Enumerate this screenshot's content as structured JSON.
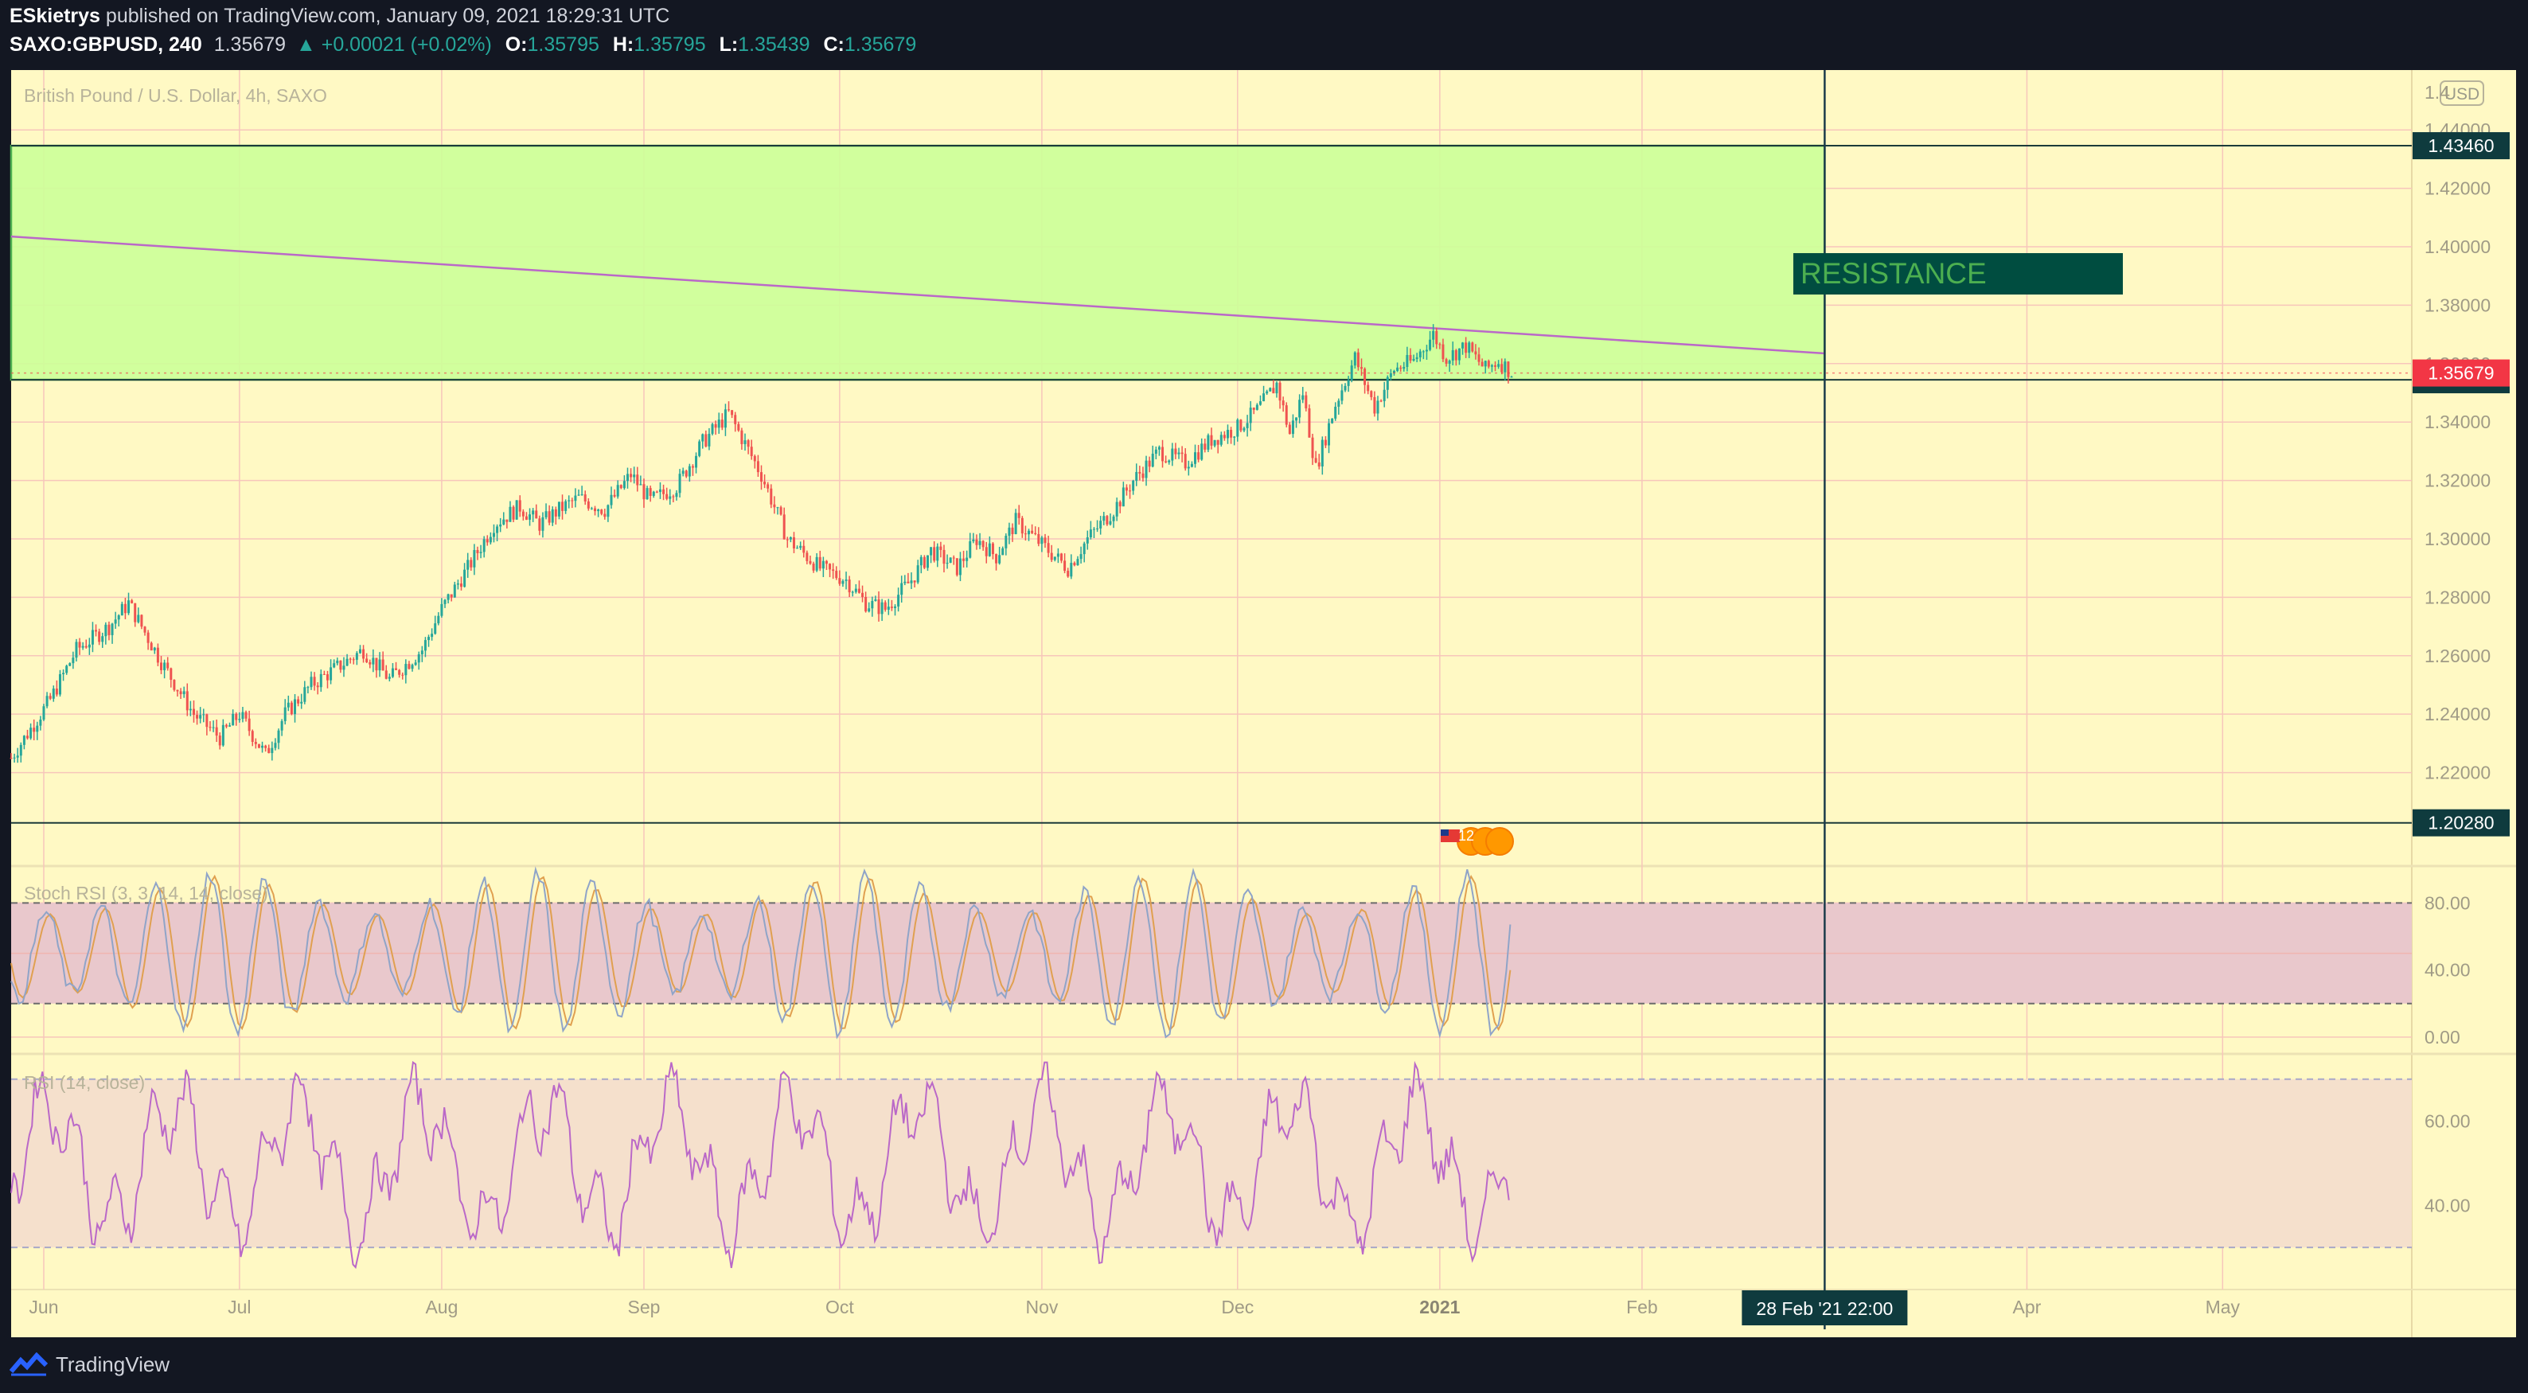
{
  "header": {
    "author": "ESkietrys",
    "published": "published on TradingView.com, January 09, 2021 18:29:31 UTC",
    "symbol": "SAXO:GBPUSD, 240",
    "last": "1.35679",
    "change": "▲ +0.00021 (+0.02%)",
    "o_label": "O:",
    "o_value": "1.35795",
    "h_label": "H:",
    "h_value": "1.35795",
    "l_label": "L:",
    "l_value": "1.35439",
    "c_label": "C:",
    "c_value": "1.35679"
  },
  "chart_data": {
    "type": "line",
    "title": "British Pound / U.S. Dollar, 4h, SAXO",
    "currency_badge": "USD",
    "price_axis": {
      "ylim": [
        1.188,
        1.4605
      ],
      "ticks": [
        "1.44000",
        "1.42000",
        "1.40000",
        "1.38000",
        "1.36000",
        "1.34000",
        "1.32000",
        "1.30000",
        "1.28000",
        "1.26000",
        "1.24000",
        "1.22000"
      ],
      "tick_values": [
        1.44,
        1.42,
        1.4,
        1.38,
        1.36,
        1.34,
        1.32,
        1.3,
        1.28,
        1.26,
        1.24,
        1.22
      ],
      "top_partial_label": "1.4"
    },
    "time_axis": {
      "labels": [
        "Jun",
        "Jul",
        "Aug",
        "Sep",
        "Oct",
        "Nov",
        "Dec",
        "2021",
        "Feb",
        "Mar",
        "Apr",
        "May"
      ],
      "day_offsets": [
        -15,
        15,
        46,
        77,
        107,
        138,
        168,
        199,
        230,
        258,
        289,
        319
      ],
      "crosshair_label": "28 Feb '21   22:00",
      "crosshair_day": 258,
      "xlim_days": [
        -20,
        348
      ]
    },
    "zones": [
      {
        "name": "RESISTANCE",
        "top": 1.4346,
        "bottom": 1.35448,
        "fill": "#ccff99",
        "stroke": "#4caf50"
      }
    ],
    "annotation": {
      "text": "RESISTANCE",
      "bg": "#004d40",
      "color": "#4caf50"
    },
    "horizontal_levels": [
      {
        "value": 1.4346,
        "label": "1.43460",
        "color": "#1b3b3a"
      },
      {
        "value": 1.35448,
        "label": "1.35448",
        "color": "#1b3b3a"
      },
      {
        "value": 1.2028,
        "label": "1.20280",
        "color": "#1b3b3a"
      }
    ],
    "last_price": {
      "value": 1.35679,
      "label": "1.35679",
      "color": "#f23645"
    },
    "trendline": {
      "from_day": -20,
      "from_value": 1.4035,
      "to_day": 258,
      "to_value": 1.3635,
      "color": "#ba68c8"
    },
    "series": [
      {
        "name": "GBPUSD",
        "x_days": [
          -20,
          -14,
          -10,
          -5,
          -2,
          3,
          8,
          12,
          15,
          19,
          22,
          26,
          30,
          34,
          38,
          43,
          46,
          50,
          54,
          58,
          61,
          64,
          67,
          71,
          75,
          78,
          82,
          86,
          90,
          95,
          99,
          104,
          108,
          111,
          114,
          118,
          121,
          125,
          128,
          131,
          134,
          138,
          142,
          145,
          149,
          152,
          156,
          160,
          164,
          168,
          171,
          174,
          176,
          178,
          180,
          183,
          186,
          189,
          192,
          195,
          198,
          200,
          203,
          206,
          208,
          210
        ],
        "y_values": [
          1.225,
          1.245,
          1.262,
          1.27,
          1.278,
          1.258,
          1.24,
          1.232,
          1.24,
          1.226,
          1.24,
          1.25,
          1.256,
          1.262,
          1.252,
          1.262,
          1.276,
          1.29,
          1.305,
          1.311,
          1.305,
          1.31,
          1.314,
          1.31,
          1.322,
          1.313,
          1.318,
          1.333,
          1.343,
          1.322,
          1.3,
          1.29,
          1.286,
          1.278,
          1.276,
          1.286,
          1.296,
          1.29,
          1.3,
          1.294,
          1.306,
          1.298,
          1.29,
          1.3,
          1.31,
          1.32,
          1.33,
          1.326,
          1.334,
          1.338,
          1.344,
          1.353,
          1.336,
          1.35,
          1.324,
          1.346,
          1.362,
          1.345,
          1.358,
          1.361,
          1.37,
          1.362,
          1.366,
          1.358,
          1.361,
          1.357
        ]
      }
    ],
    "stoch_rsi": {
      "title": "Stoch RSI (3, 3, 14, 14, close)",
      "ticks": [
        "80.00",
        "40.00",
        "0.00"
      ],
      "tick_values": [
        80,
        40,
        0
      ],
      "band": [
        20,
        80
      ],
      "ylim": [
        -10,
        102
      ]
    },
    "rsi": {
      "title": "RSI (14, close)",
      "ticks": [
        "60.00",
        "40.00"
      ],
      "tick_values": [
        60,
        40
      ],
      "band": [
        30,
        70
      ],
      "ylim": [
        20,
        76
      ]
    },
    "events_badge": "12"
  },
  "footer": {
    "brand": "TradingView"
  }
}
